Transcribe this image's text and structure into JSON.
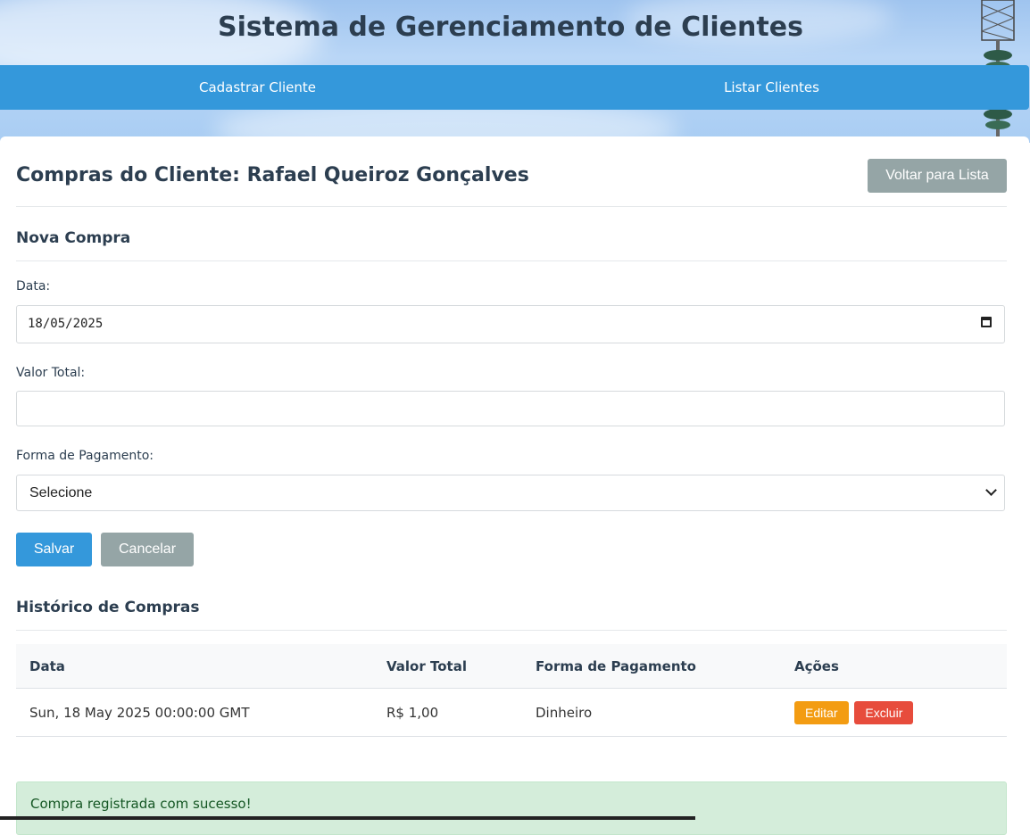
{
  "app": {
    "title": "Sistema de Gerenciamento de Clientes"
  },
  "nav": {
    "items": [
      {
        "label": "Cadastrar Cliente"
      },
      {
        "label": "Listar Clientes"
      }
    ]
  },
  "page": {
    "title": "Compras do Cliente: Rafael Queiroz Gonçalves",
    "back_button": "Voltar para Lista"
  },
  "form": {
    "heading": "Nova Compra",
    "date_label": "Data:",
    "date_value": "18/05/2025",
    "total_label": "Valor Total:",
    "total_value": "",
    "payment_label": "Forma de Pagamento:",
    "payment_selected": "Selecione",
    "save_label": "Salvar",
    "cancel_label": "Cancelar"
  },
  "history": {
    "heading": "Histórico de Compras",
    "columns": [
      "Data",
      "Valor Total",
      "Forma de Pagamento",
      "Ações"
    ],
    "rows": [
      {
        "date": "Sun, 18 May 2025 00:00:00 GMT",
        "total": "R$ 1,00",
        "payment": "Dinheiro",
        "edit": "Editar",
        "delete": "Excluir"
      }
    ]
  },
  "alert": {
    "message": "Compra registrada com sucesso!"
  },
  "colors": {
    "primary": "#3498db",
    "secondary": "#95a5a6",
    "warning": "#f39c12",
    "danger": "#e74c3c",
    "success_bg": "#d4edda",
    "heading": "#2c3e50"
  }
}
